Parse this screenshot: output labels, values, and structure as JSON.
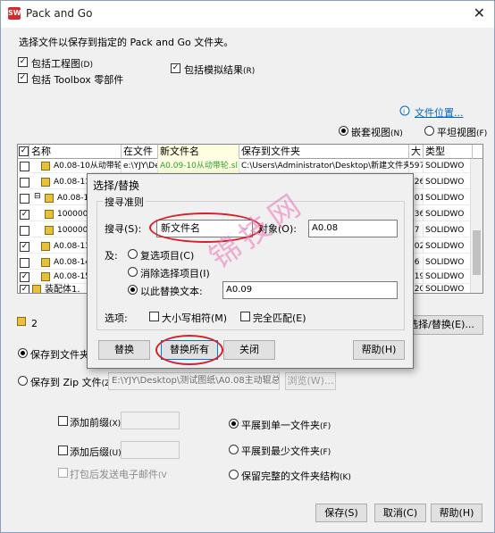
{
  "window": {
    "title": "Pack and Go",
    "close_glyph": "✕",
    "app_icon_text": "SW"
  },
  "intro": "选择文件以保存到指定的 Pack and Go 文件夹。",
  "options": {
    "include_drawings": "包括工程图",
    "include_drawings_key": "(D)",
    "include_toolbox": "包括 Toolbox 零部件",
    "include_sim": "包括模拟结果",
    "include_sim_key": "(R)"
  },
  "file_location_link": "文件位置...",
  "views": {
    "nested": "嵌套视图",
    "nested_key": "(N)",
    "flat": "平坦视图",
    "flat_key": "(F)"
  },
  "table": {
    "headers": [
      "名称",
      "在文件",
      "新文件名",
      "保存到文件夹",
      "大",
      "类型"
    ],
    "rows": [
      {
        "name": "A0.08-10从动带轮.sldprt",
        "infile": "e:\\YJY\\De",
        "newname": "A0.09-10从动带轮.sl",
        "folder": "C:\\Users\\Administrator\\Desktop\\新建文件夹",
        "size": "597",
        "type": "SOLIDWO",
        "checked": false
      },
      {
        "name": "A0.08-11主",
        "infile": "",
        "newname": "",
        "folder": "",
        "size": "126",
        "type": "SOLIDWO",
        "checked": false
      },
      {
        "name": "A0.08-12",
        "infile": "",
        "newname": "",
        "folder": "",
        "size": "101",
        "type": "SOLIDWO",
        "checked": false
      },
      {
        "name": "1000000",
        "infile": "",
        "newname": "",
        "folder": "",
        "size": "136",
        "type": "SOLIDWO",
        "checked": true
      },
      {
        "name": "1000000",
        "infile": "",
        "newname": "",
        "folder": "",
        "size": "77",
        "type": "SOLIDWO",
        "checked": false
      },
      {
        "name": "A0.08-13",
        "infile": "",
        "newname": "",
        "folder": "",
        "size": "102",
        "type": "SOLIDWO",
        "checked": true
      },
      {
        "name": "A0.08-14",
        "infile": "",
        "newname": "",
        "folder": "",
        "size": "86",
        "type": "SOLIDWO",
        "checked": false
      },
      {
        "name": "A0.08-15",
        "infile": "",
        "newname": "",
        "folder": "",
        "size": "119",
        "type": "SOLIDWO",
        "checked": true
      },
      {
        "name": "装配体1.",
        "infile": "",
        "newname": "",
        "folder": "",
        "size": "120",
        "type": "SOLIDWO",
        "checked": true
      }
    ]
  },
  "count": "2",
  "select_replace_btn": "选择/替换(E)...",
  "save_to_folder": "保存到文件夹",
  "save_to_zip": "保存到 Zip 文件",
  "save_to_zip_key": "(Z):",
  "zip_path": "E:\\YJY\\Desktop\\测试图纸\\A0.08主动辊总成",
  "browse_btn": "浏览(W)...",
  "prefix": {
    "label": "添加前缀",
    "key": "(X):"
  },
  "suffix": {
    "label": "添加后缀",
    "key": "(U)"
  },
  "email": {
    "label": "打包后发送电子邮件",
    "key": "(V"
  },
  "flatten": {
    "single": "平展到单一文件夹",
    "single_key": "(F)",
    "minimal": "平展到最少文件夹",
    "minimal_key": "(F)",
    "full": "保留完整的文件夹结构",
    "full_key": "(K)"
  },
  "bottom_buttons": {
    "save": "保存(S)",
    "cancel": "取消(C)",
    "help": "帮助(H)"
  },
  "dialog": {
    "title": "选择/替换",
    "group_title": "搜寻准则",
    "search_label": "搜寻(S):",
    "search_value": "新文件名",
    "object_label": "对象(O):",
    "object_value": "A0.08",
    "and_label": "及:",
    "radio_select": "复选项目(C)",
    "radio_deselect": "消除选择项目(I)",
    "radio_replace": "以此替换文本:",
    "replace_value": "A0.09",
    "options_label": "选项:",
    "match_case": "大小写相符(M)",
    "whole_match": "完全匹配(E)",
    "replace_btn": "替换",
    "replace_all_btn": "替换所有",
    "close_btn": "关闭",
    "help_btn": "帮助(H)"
  },
  "watermark": "锦技网",
  "colors": {
    "highlight": "#ffffe0",
    "red_annotation": "#d6202a",
    "link": "#0066cc",
    "new_name_green": "#2ca02c"
  }
}
